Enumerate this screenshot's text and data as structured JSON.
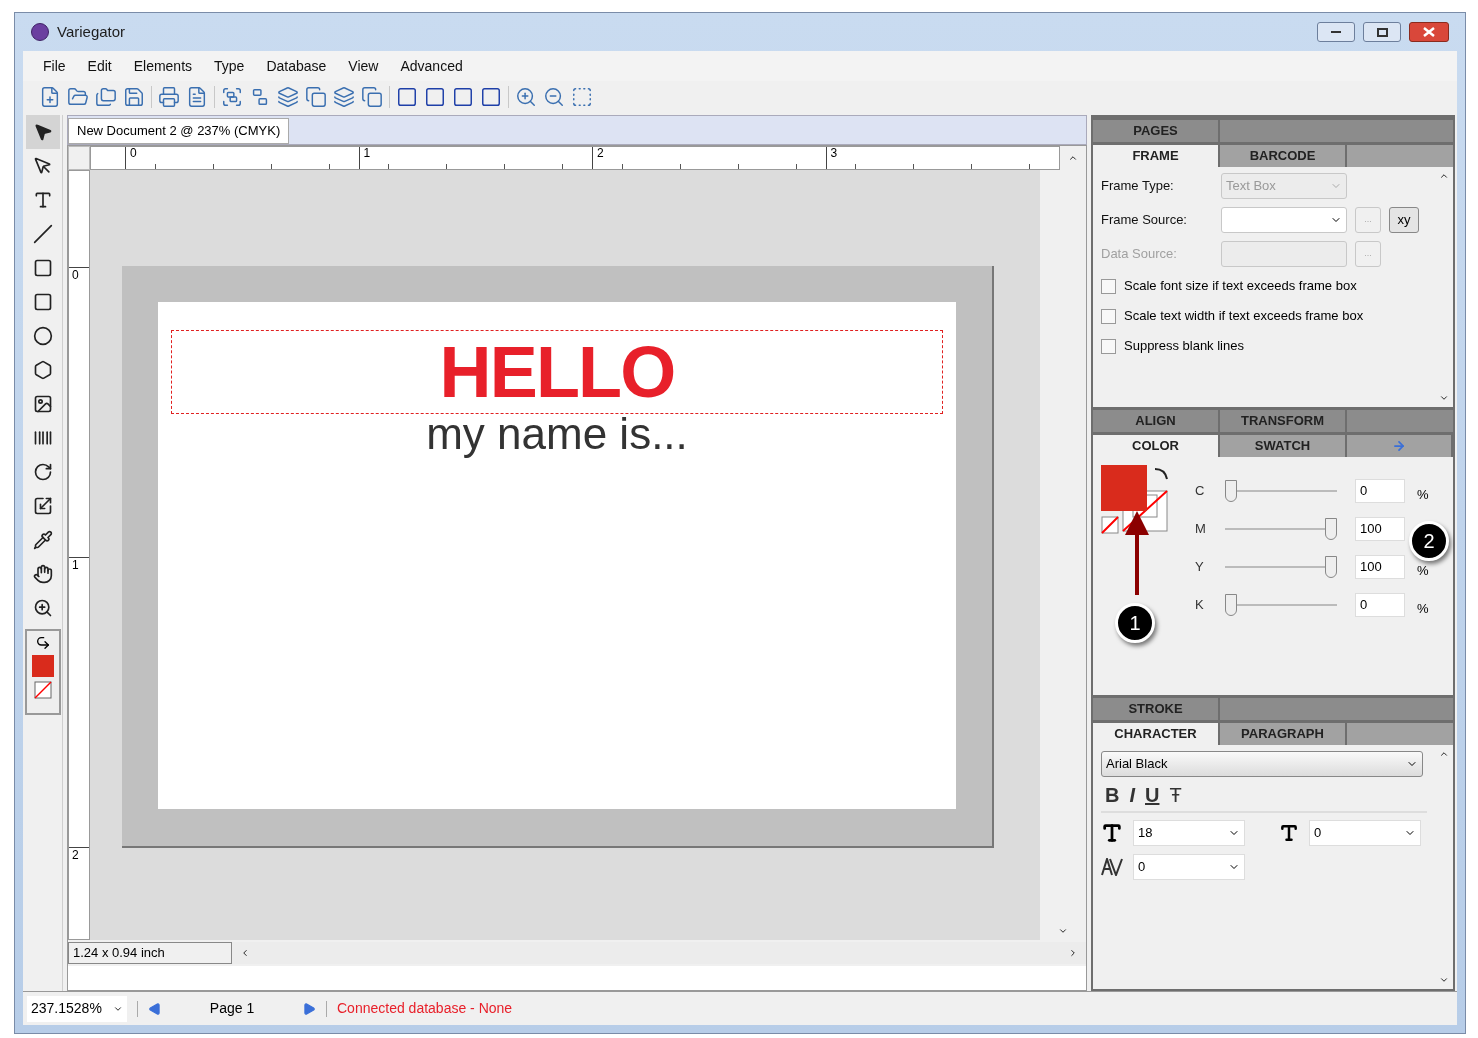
{
  "window": {
    "title": "Variegator"
  },
  "menu": [
    "File",
    "Edit",
    "Elements",
    "Type",
    "Database",
    "View",
    "Advanced"
  ],
  "tools": [
    {
      "kind": "pointer",
      "selected": true
    },
    {
      "kind": "direct",
      "selected": false
    },
    {
      "kind": "text",
      "selected": false
    },
    {
      "kind": "line",
      "selected": false
    },
    {
      "kind": "rect",
      "selected": false
    },
    {
      "kind": "rounded",
      "selected": false
    },
    {
      "kind": "ellipse",
      "selected": false
    },
    {
      "kind": "polygon",
      "selected": false
    },
    {
      "kind": "image",
      "selected": false
    },
    {
      "kind": "barcode",
      "selected": false
    },
    {
      "kind": "rotate",
      "selected": false
    },
    {
      "kind": "scale",
      "selected": false
    },
    {
      "kind": "eyedropper",
      "selected": false
    },
    {
      "kind": "hand",
      "selected": false
    },
    {
      "kind": "zoom",
      "selected": false
    }
  ],
  "document": {
    "tab": "New Document 2 @ 237% (CMYK)",
    "ruler_h": [
      "0",
      "1",
      "2",
      "3"
    ],
    "ruler_v": [
      "0",
      "1",
      "2"
    ],
    "heading": "HELLO",
    "subheading": "my name is...",
    "size": "1.24 x 0.94 inch"
  },
  "frame_panel": {
    "top_tabs": [
      {
        "label": "PAGES",
        "selected": false
      }
    ],
    "tabs": [
      {
        "label": "FRAME",
        "selected": true
      },
      {
        "label": "BARCODE",
        "selected": false
      }
    ],
    "fields": [
      {
        "label": "Frame Type:",
        "value": "Text Box",
        "disabled": true
      },
      {
        "label": "Frame Source:",
        "disabled": false,
        "browse": "...",
        "xy": "xy"
      },
      {
        "label": "Data Source:",
        "disabled": true,
        "browse": "..."
      }
    ],
    "checkboxes": [
      {
        "label": "Scale font size if text exceeds frame box",
        "checked": false
      },
      {
        "label": "Scale text width if text exceeds frame box",
        "checked": false
      },
      {
        "label": "Suppress blank lines",
        "checked": false
      }
    ]
  },
  "color_panel": {
    "top_tabs": [
      {
        "label": "ALIGN",
        "selected": false
      },
      {
        "label": "TRANSFORM",
        "selected": false
      }
    ],
    "tabs": [
      {
        "label": "COLOR",
        "selected": true
      },
      {
        "label": "SWATCH",
        "selected": false
      }
    ],
    "channels": [
      {
        "name": "C",
        "level": 0,
        "value": "0",
        "unit": "%"
      },
      {
        "name": "M",
        "level": 1,
        "value": "100"
      },
      {
        "name": "Y",
        "level": 1,
        "value": "100",
        "unit": "%"
      },
      {
        "name": "K",
        "level": 0,
        "value": "0",
        "unit": "%"
      }
    ],
    "callouts": [
      "1",
      "2"
    ]
  },
  "character_panel": {
    "top_tabs": [
      {
        "label": "STROKE",
        "selected": false
      }
    ],
    "tabs": [
      {
        "label": "CHARACTER",
        "selected": true
      },
      {
        "label": "PARAGRAPH",
        "selected": false
      }
    ],
    "font": "Arial Black",
    "styles": [
      "B",
      "I",
      "U",
      "Ŧ"
    ],
    "size": "18",
    "leading": "0",
    "tracking": "0"
  },
  "status_bar": {
    "zoom": "237.1528%",
    "page": "Page 1",
    "database": "Connected database - None"
  }
}
